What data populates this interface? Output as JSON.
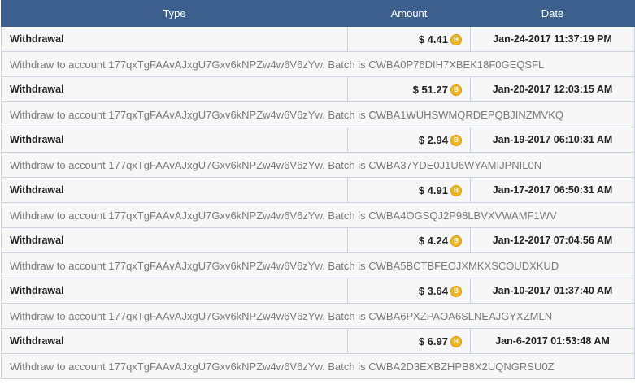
{
  "colors": {
    "header_bg": "#3d5f8e",
    "row_bg": "#f7f7f7",
    "border": "#c9d3df",
    "description_text": "#7a7a7a",
    "coin": "#f3b51f"
  },
  "table": {
    "headers": {
      "type": "Type",
      "amount": "Amount",
      "date": "Date"
    },
    "currency_icon": "bitcoin-icon",
    "coin_glyph": "B",
    "rows": [
      {
        "type": "Withdrawal",
        "amount": "$ 4.41",
        "date": "Jan-24-2017 11:37:19 PM",
        "description": "Withdraw to account 177qxTgFAAvAJxgU7Gxv6kNPZw4w6V6zYw. Batch is CWBA0P76DIH7XBEK18F0GEQSFL"
      },
      {
        "type": "Withdrawal",
        "amount": "$ 51.27",
        "date": "Jan-20-2017 12:03:15 AM",
        "description": "Withdraw to account 177qxTgFAAvAJxgU7Gxv6kNPZw4w6V6zYw. Batch is CWBA1WUHSWMQRDEPQBJINZMVKQ"
      },
      {
        "type": "Withdrawal",
        "amount": "$ 2.94",
        "date": "Jan-19-2017 06:10:31 AM",
        "description": "Withdraw to account 177qxTgFAAvAJxgU7Gxv6kNPZw4w6V6zYw. Batch is CWBA37YDE0J1U6WYAMIJPNIL0N"
      },
      {
        "type": "Withdrawal",
        "amount": "$ 4.91",
        "date": "Jan-17-2017 06:50:31 AM",
        "description": "Withdraw to account 177qxTgFAAvAJxgU7Gxv6kNPZw4w6V6zYw. Batch is CWBA4OGSQJ2P98LBVXVWAMF1WV"
      },
      {
        "type": "Withdrawal",
        "amount": "$ 4.24",
        "date": "Jan-12-2017 07:04:56 AM",
        "description": "Withdraw to account 177qxTgFAAvAJxgU7Gxv6kNPZw4w6V6zYw. Batch is CWBA5BCTBFEOJXMKXSCOUDXKUD"
      },
      {
        "type": "Withdrawal",
        "amount": "$ 3.64",
        "date": "Jan-10-2017 01:37:40 AM",
        "description": "Withdraw to account 177qxTgFAAvAJxgU7Gxv6kNPZw4w6V6zYw. Batch is CWBA6PXZPAOA6SLNEAJGYXZMLN"
      },
      {
        "type": "Withdrawal",
        "amount": "$ 6.97",
        "date": "Jan-6-2017 01:53:48 AM",
        "description": "Withdraw to account 177qxTgFAAvAJxgU7Gxv6kNPZw4w6V6zYw. Batch is CWBA2D3EXBZHPB8X2UQNGRSU0Z"
      }
    ]
  }
}
